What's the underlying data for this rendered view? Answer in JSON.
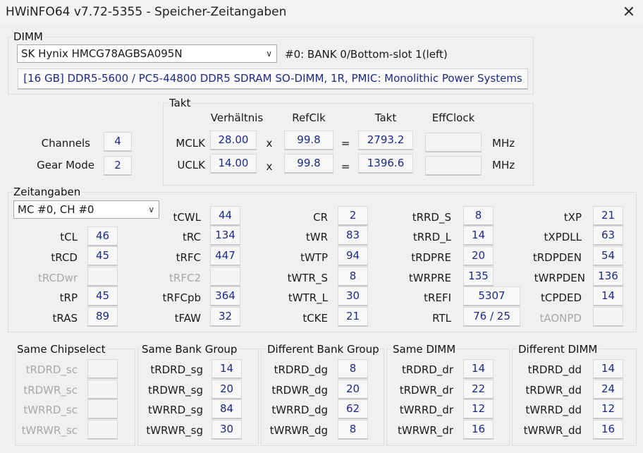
{
  "window": {
    "title": "HWiNFO64 v7.72-5355 - Speicher-Zeitangaben",
    "close_glyph": "✕"
  },
  "dimm": {
    "group_label": "DIMM",
    "selected_module": "SK Hynix HMCG78AGBSA095N",
    "slot_info": "#0: BANK 0/Bottom-slot 1(left)",
    "module_details": "[16 GB] DDR5-5600 / PC5-44800 DDR5 SDRAM SO-DIMM, 1R, PMIC: Monolithic Power Systems"
  },
  "channels": {
    "label": "Channels",
    "value": "4"
  },
  "gear_mode": {
    "label": "Gear Mode",
    "value": "2"
  },
  "takt": {
    "group_label": "Takt",
    "headers": {
      "ratio": "Verhältnis",
      "refclk": "RefClk",
      "takt": "Takt",
      "effclock": "EffClock"
    },
    "mclk": {
      "label": "MCLK",
      "ratio": "28.00",
      "x": "x",
      "refclk": "99.8",
      "eq": "=",
      "takt": "2793.2",
      "effclock": "",
      "unit": "MHz"
    },
    "uclk": {
      "label": "UCLK",
      "ratio": "14.00",
      "x": "x",
      "refclk": "99.8",
      "eq": "=",
      "takt": "1396.6",
      "effclock": "",
      "unit": "MHz"
    }
  },
  "zeitangaben": {
    "group_label": "Zeitangaben",
    "channel_select": "MC #0, CH #0",
    "t": {
      "tCL": "46",
      "tRCD": "45",
      "tRCDwr": "",
      "tRP": "45",
      "tRAS": "89",
      "tCWL": "44",
      "tRC": "134",
      "tRFC": "447",
      "tRFC2": "",
      "tRFCpb": "364",
      "tFAW": "32",
      "CR": "2",
      "tWR": "83",
      "tWTP": "94",
      "tWTR_S": "8",
      "tWTR_L": "30",
      "tCKE": "21",
      "tRRD_S": "8",
      "tRRD_L": "14",
      "tRDPRE": "20",
      "tWRPRE": "135",
      "tREFI": "5307",
      "RTL": "76 / 25",
      "tXP": "21",
      "tXPDLL": "63",
      "tRDPDEN": "54",
      "tWRPDEN": "136",
      "tCPDED": "14",
      "tAONPD": ""
    }
  },
  "bottom": {
    "same_chipselect": {
      "label": "Same Chipselect",
      "rows": [
        [
          "tRDRD_sc",
          ""
        ],
        [
          "tRDWR_sc",
          ""
        ],
        [
          "tWRRD_sc",
          ""
        ],
        [
          "tWRWR_sc",
          ""
        ]
      ]
    },
    "same_bank_group": {
      "label": "Same Bank Group",
      "rows": [
        [
          "tRDRD_sg",
          "14"
        ],
        [
          "tRDWR_sg",
          "20"
        ],
        [
          "tWRRD_sg",
          "84"
        ],
        [
          "tWRWR_sg",
          "30"
        ]
      ]
    },
    "different_bank_group": {
      "label": "Different Bank Group",
      "rows": [
        [
          "tRDRD_dg",
          "8"
        ],
        [
          "tRDWR_dg",
          "20"
        ],
        [
          "tWRRD_dg",
          "62"
        ],
        [
          "tWRWR_dg",
          "8"
        ]
      ]
    },
    "same_dimm": {
      "label": "Same DIMM",
      "rows": [
        [
          "tRDRD_dr",
          "14"
        ],
        [
          "tRDWR_dr",
          "22"
        ],
        [
          "tWRRD_dr",
          "12"
        ],
        [
          "tWRWR_dr",
          "16"
        ]
      ]
    },
    "different_dimm": {
      "label": "Different DIMM",
      "rows": [
        [
          "tRDRD_dd",
          "14"
        ],
        [
          "tRDWR_dd",
          "24"
        ],
        [
          "tWRRD_dd",
          "12"
        ],
        [
          "tWRWR_dd",
          "16"
        ]
      ]
    }
  }
}
